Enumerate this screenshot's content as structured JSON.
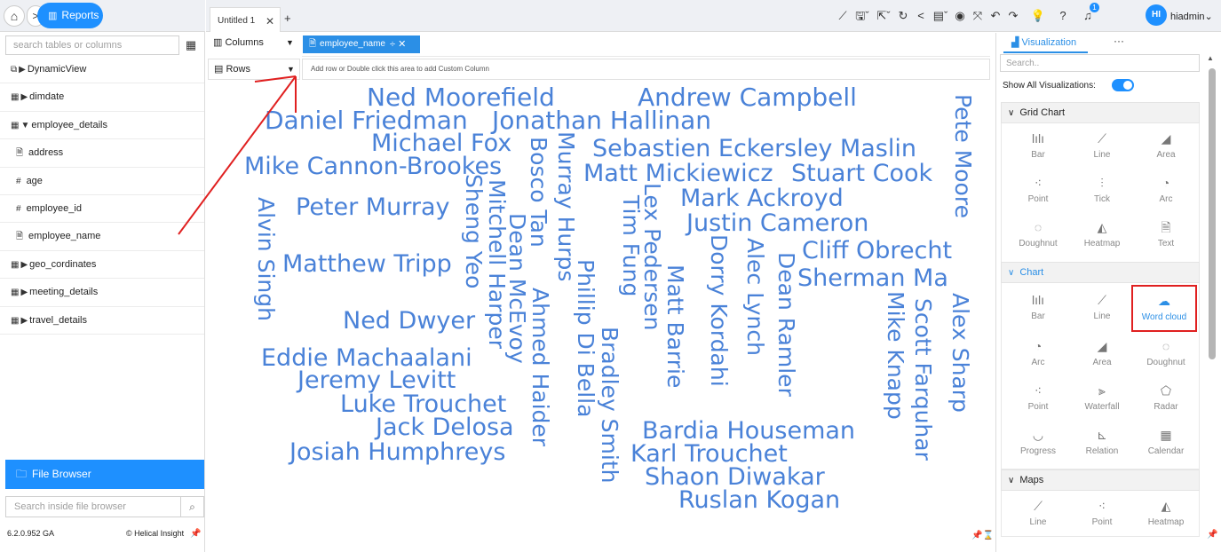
{
  "nav": {
    "home_icon": "home-icon",
    "forward_label": ">",
    "reports_label": "Reports",
    "reports_icon": "bar-chart-icon"
  },
  "left_panel": {
    "search_placeholder": "search tables or columns",
    "items": [
      {
        "label": "DynamicView",
        "icon": "view-icon",
        "arrow": "▶"
      },
      {
        "label": "dimdate",
        "icon": "table-icon",
        "arrow": "▶"
      },
      {
        "label": "employee_details",
        "icon": "table-icon",
        "arrow": "▼"
      },
      {
        "label": "address",
        "icon": "text-field-icon",
        "arrow": ""
      },
      {
        "label": "age",
        "icon": "number-field-icon",
        "arrow": ""
      },
      {
        "label": "employee_id",
        "icon": "number-field-icon",
        "arrow": ""
      },
      {
        "label": "employee_name",
        "icon": "text-field-icon",
        "arrow": ""
      },
      {
        "label": "geo_cordinates",
        "icon": "table-icon",
        "arrow": "▶"
      },
      {
        "label": "meeting_details",
        "icon": "table-icon",
        "arrow": "▶"
      },
      {
        "label": "travel_details",
        "icon": "table-icon",
        "arrow": "▶"
      }
    ],
    "file_browser_label": "File Browser",
    "file_search_placeholder": "Search inside file browser",
    "version": "6.2.0.952 GA",
    "brand": "Helical Insight"
  },
  "tabs": [
    {
      "label": "Untitled 1",
      "close": "✕"
    }
  ],
  "tab_add": "+",
  "toolbar_icons": [
    "line-chart-icon",
    "save-icon",
    "export-icon",
    "refresh-icon",
    "share-icon",
    "layout-icon",
    "preview-icon",
    "fullscreen-icon",
    "undo-icon",
    "redo-icon",
    "lightbulb-icon",
    "help-icon",
    "bell-icon"
  ],
  "notification_count": "1",
  "user": {
    "initials": "HI",
    "name": "hiadmin"
  },
  "shelves": {
    "columns_label": "Columns",
    "rows_label": "Rows",
    "column_chip": "employee_name",
    "rows_placeholder": "Add row or Double click this area to add Custom Column"
  },
  "wordcloud": {
    "color": "#4a82d8",
    "words": [
      "Ned Moorefield",
      "Andrew Campbell",
      "Daniel Friedman",
      "Jonathan Hallinan",
      "Michael Fox",
      "Sebastien Eckersley Maslin",
      "Mike Cannon-Brookes",
      "Matt Mickiewicz",
      "Stuart Cook",
      "Peter Murray",
      "Mark Ackroyd",
      "Justin Cameron",
      "Cliff Obrecht",
      "Matthew Tripp",
      "Sherman Ma",
      "Ned Dwyer",
      "Eddie Machaalani",
      "Jeremy Levitt",
      "Luke Trouchet",
      "Jack Delosa",
      "Bardia Houseman",
      "Josiah Humphreys",
      "Karl Trouchet",
      "Shaon Diwakar",
      "Ruslan Kogan",
      "Pete Moore",
      "Alvin Singh",
      "Sheng Yeo",
      "Mitchell Harper",
      "Bosco Tan",
      "Dean McEvoy",
      "Murray Hurps",
      "Ahmed Haider",
      "Phillip Di Bella",
      "Tim Fung",
      "Bradley Smith",
      "Lex Pedersen",
      "Matt Barrie",
      "Dorry Kordahi",
      "Alec Lynch",
      "Dean Ramler",
      "Mike Knapp",
      "Scott Farquhar",
      "Alex Sharp"
    ]
  },
  "viz_panel": {
    "tab_label": "Visualization",
    "more": "···",
    "search_placeholder": "Search..",
    "show_all_label": "Show All Visualizations:",
    "show_all_on": true,
    "sections": [
      {
        "title": "Grid Chart",
        "items": [
          {
            "label": "Bar",
            "icon": "bar-icon"
          },
          {
            "label": "Line",
            "icon": "line-icon"
          },
          {
            "label": "Area",
            "icon": "area-icon"
          },
          {
            "label": "Point",
            "icon": "point-icon"
          },
          {
            "label": "Tick",
            "icon": "tick-icon"
          },
          {
            "label": "Arc",
            "icon": "arc-icon"
          },
          {
            "label": "Doughnut",
            "icon": "doughnut-icon"
          },
          {
            "label": "Heatmap",
            "icon": "heatmap-icon"
          },
          {
            "label": "Text",
            "icon": "text-icon"
          }
        ]
      },
      {
        "title": "Chart",
        "items": [
          {
            "label": "Bar",
            "icon": "bar-icon"
          },
          {
            "label": "Line",
            "icon": "line-icon"
          },
          {
            "label": "Word cloud",
            "icon": "cloud-icon"
          },
          {
            "label": "Arc",
            "icon": "arc-icon"
          },
          {
            "label": "Area",
            "icon": "area-icon"
          },
          {
            "label": "Doughnut",
            "icon": "doughnut-icon"
          },
          {
            "label": "Point",
            "icon": "point-icon"
          },
          {
            "label": "Waterfall",
            "icon": "waterfall-icon"
          },
          {
            "label": "Radar",
            "icon": "radar-icon"
          },
          {
            "label": "Progress",
            "icon": "progress-icon"
          },
          {
            "label": "Relation",
            "icon": "relation-icon"
          },
          {
            "label": "Calendar",
            "icon": "calendar-icon"
          }
        ]
      },
      {
        "title": "Maps",
        "items": [
          {
            "label": "Line",
            "icon": "line-icon"
          },
          {
            "label": "Point",
            "icon": "point-icon"
          },
          {
            "label": "Heatmap",
            "icon": "heatmap-icon"
          }
        ]
      }
    ],
    "selected": "Word cloud"
  },
  "annotation_color": "#e02020"
}
